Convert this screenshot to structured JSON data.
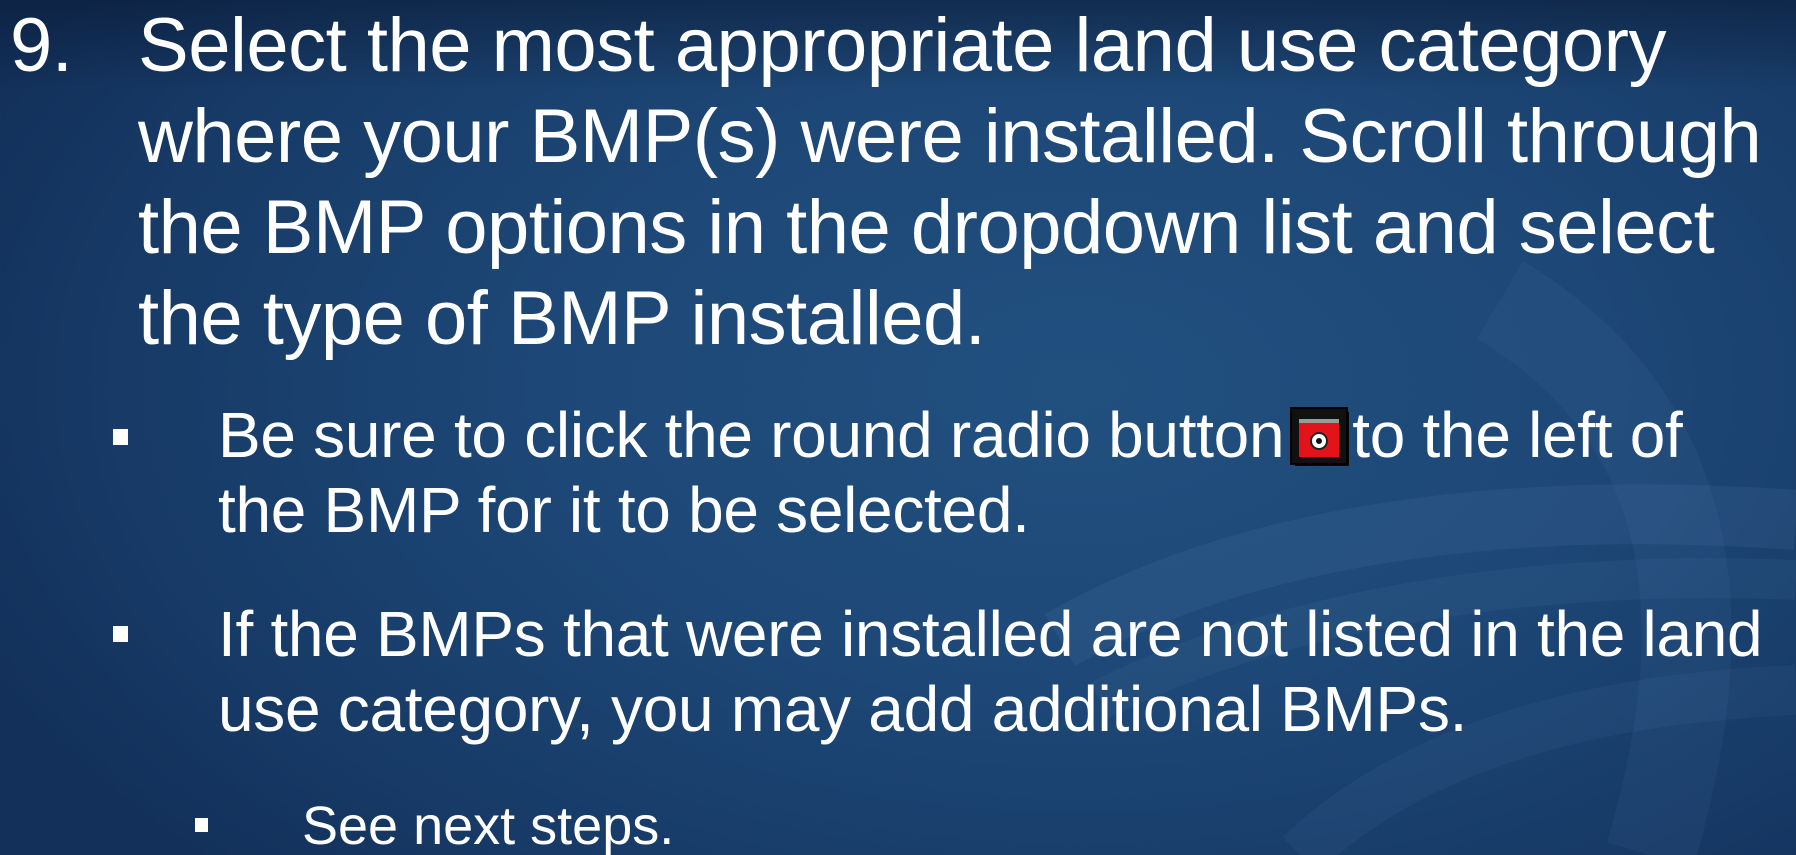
{
  "step": {
    "number": "9.",
    "text": "Select the most appropriate land use category where your BMP(s) were installed. Scroll through the BMP options in the dropdown list and select the type of BMP installed."
  },
  "bullets": [
    {
      "text_before_icon": "Be sure to click the round radio button",
      "icon": "radio-button-icon",
      "text_after_icon": "to the left of the BMP for it to be selected."
    },
    {
      "text": "If the BMPs that were installed are not listed in the land use category, you may add additional BMPs."
    }
  ],
  "sub_bullets": [
    {
      "text": "See next steps."
    }
  ],
  "colors": {
    "background": "#1d4776",
    "text": "#ffffff",
    "icon_red": "#e3131b"
  }
}
